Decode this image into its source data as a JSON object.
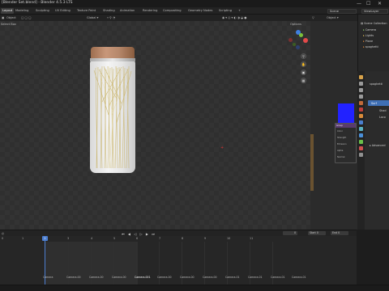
{
  "window": {
    "title": "[Blender Set.blend] - Blender 4.5.3 LTS",
    "controls": [
      "—",
      "☐",
      "✕"
    ]
  },
  "menubar": {
    "tabs": [
      "Layout",
      "Modeling",
      "Sculpting",
      "UV Editing",
      "Texture Paint",
      "Shading",
      "Animation",
      "Rendering",
      "Compositing",
      "Geometry Nodes",
      "Scripting"
    ],
    "active_tab": "Layout",
    "scene_selector": "Scene",
    "viewlayer_selector": "ViewLayer"
  },
  "viewport_header": {
    "left_items": [
      "Object"
    ],
    "transform_orientation": "Global",
    "sub_label": "Select Box"
  },
  "viewport": {
    "options_label": "Options"
  },
  "nav_gizmo": {
    "axes": [
      "X",
      "Y",
      "Z"
    ],
    "colors": {
      "x": "#e44a4a",
      "y": "#7bbf3b",
      "z": "#3f7fe0"
    }
  },
  "top_right_header": {
    "mode_selector": "Object"
  },
  "outliner": {
    "rows": [
      {
        "label": "Scene Collection",
        "icon": "collection-icon"
      },
      {
        "label": "Camera",
        "icon": "camera-icon"
      },
      {
        "label": "Lights",
        "icon": "light-icon"
      },
      {
        "label": "Plane",
        "icon": "mesh-icon"
      },
      {
        "label": "spaghetti",
        "icon": "mesh-icon"
      }
    ]
  },
  "properties": {
    "object_name": "spaghetti",
    "rows": [
      "Shad",
      "Loco",
      "Advanced"
    ],
    "active_button": "Surf"
  },
  "node_overlay": {
    "title": "Group",
    "rows": [
      "Color",
      "Strength",
      "Emission",
      "Alpha",
      "Normal"
    ]
  },
  "timeline": {
    "header_items": [
      "Playback",
      "Keying",
      "View",
      "Marker"
    ],
    "current_frame": "0",
    "start_label": "Start",
    "start_value": "0",
    "end_label": "End",
    "end_value": "0",
    "ruler": [
      "0",
      "1",
      "2",
      "3",
      "4",
      "5",
      "6",
      "7",
      "8",
      "9",
      "10",
      "11"
    ],
    "markers": [
      "Camera",
      "Camera.00",
      "Camera.00",
      "Camera.00",
      "Camera.001",
      "Camera.00",
      "Camera.00",
      "Camera.00",
      "Camera.01",
      "Camera.01",
      "Camera.01",
      "Camera.01"
    ]
  }
}
